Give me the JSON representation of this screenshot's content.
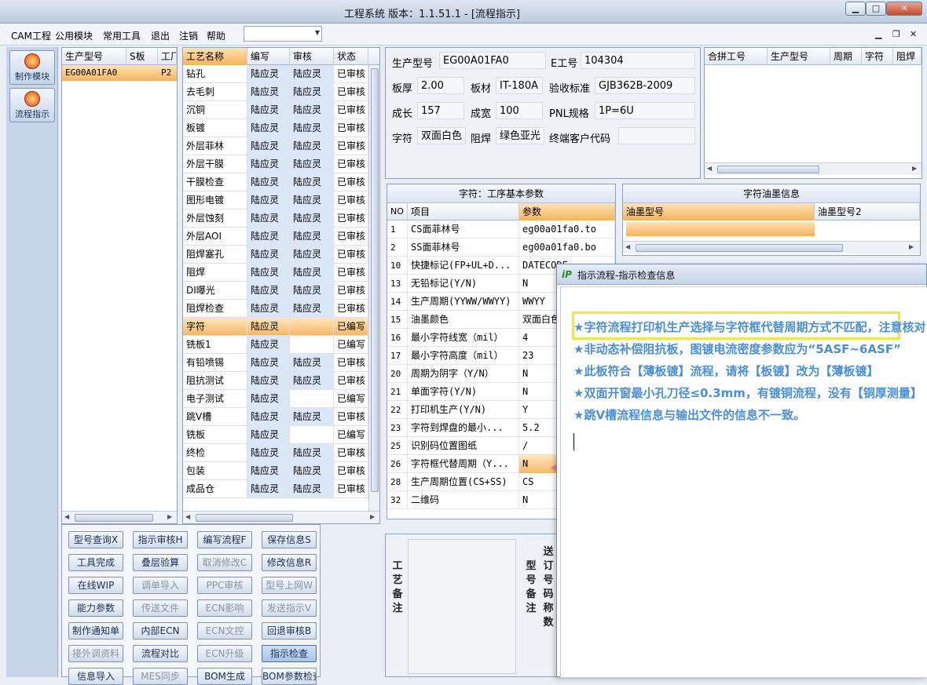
{
  "window": {
    "title": "工程系统   版本：1.1.51.1 - [流程指示]",
    "btn_min": "▁",
    "btn_max": "□",
    "btn_close": "✕"
  },
  "menu": {
    "items": [
      "CAM工程",
      "公用模块",
      "常用工具",
      "退出",
      "注销",
      "帮助"
    ],
    "combo_value": "",
    "mdi_min": "▁",
    "mdi_restore": "❐",
    "mdi_close": "✕"
  },
  "leftbar": {
    "make_module": "制作模块",
    "flow_indicate": "流程指示"
  },
  "model_list": {
    "headers": [
      "生产型号",
      "S板",
      "工厂"
    ],
    "rows": [
      [
        "EG00A01FA0",
        "",
        "P2"
      ]
    ]
  },
  "process_list": {
    "headers": [
      "工艺名称",
      "编写",
      "审核",
      "状态"
    ],
    "rows": [
      [
        "钻孔",
        "陆应灵",
        "陆应灵",
        "已审核"
      ],
      [
        "去毛刺",
        "陆应灵",
        "陆应灵",
        "已审核"
      ],
      [
        "沉铜",
        "陆应灵",
        "陆应灵",
        "已审核"
      ],
      [
        "板镀",
        "陆应灵",
        "陆应灵",
        "已审核"
      ],
      [
        "外层菲林",
        "陆应灵",
        "陆应灵",
        "已审核"
      ],
      [
        "外层干膜",
        "陆应灵",
        "陆应灵",
        "已审核"
      ],
      [
        "干膜检查",
        "陆应灵",
        "陆应灵",
        "已审核"
      ],
      [
        "图形电镀",
        "陆应灵",
        "陆应灵",
        "已审核"
      ],
      [
        "外层蚀刻",
        "陆应灵",
        "陆应灵",
        "已审核"
      ],
      [
        "外层AOI",
        "陆应灵",
        "陆应灵",
        "已审核"
      ],
      [
        "阻焊塞孔",
        "陆应灵",
        "陆应灵",
        "已审核"
      ],
      [
        "阻焊",
        "陆应灵",
        "陆应灵",
        "已审核"
      ],
      [
        "DI曝光",
        "陆应灵",
        "陆应灵",
        "已审核"
      ],
      [
        "阻焊检查",
        "陆应灵",
        "陆应灵",
        "已审核"
      ],
      [
        "字符",
        "陆应灵",
        "",
        "已编写"
      ],
      [
        "铣板1",
        "陆应灵",
        "",
        "已编写"
      ],
      [
        "有铅喷锡",
        "陆应灵",
        "陆应灵",
        "已审核"
      ],
      [
        "阻抗测试",
        "陆应灵",
        "陆应灵",
        "已审核"
      ],
      [
        "电子测试",
        "陆应灵",
        "",
        "已编写"
      ],
      [
        "跳V槽",
        "陆应灵",
        "陆应灵",
        "已审核"
      ],
      [
        "铣板",
        "陆应灵",
        "",
        "已编写"
      ],
      [
        "终检",
        "陆应灵",
        "陆应灵",
        "已审核"
      ],
      [
        "包装",
        "陆应灵",
        "陆应灵",
        "已审核"
      ],
      [
        "成品仓",
        "陆应灵",
        "陆应灵",
        "已审核"
      ]
    ],
    "active_index": 14
  },
  "buttons": [
    [
      "型号查询X",
      "指示审核H",
      "编写流程F",
      "保存信息S"
    ],
    [
      "工具完成",
      "叠层验算",
      "取消修改C",
      "修改信息R"
    ],
    [
      "在线WIP",
      "调单导入",
      "PPC审核",
      "型号上网W"
    ],
    [
      "能力参数",
      "传送文件",
      "ECN影响",
      "发送指示V"
    ],
    [
      "制作通知单",
      "内部ECN",
      "ECN文控",
      "回退审核B"
    ],
    [
      "接外调资料",
      "流程对比",
      "ECN升级",
      "指示检查"
    ],
    [
      "信息导入",
      "MES同步",
      "BOM生成",
      "BOM参数检查"
    ]
  ],
  "buttons_disabled": [
    [
      1,
      2
    ],
    [
      2,
      1
    ],
    [
      2,
      2
    ],
    [
      2,
      3
    ],
    [
      3,
      1
    ],
    [
      3,
      2
    ],
    [
      3,
      3
    ],
    [
      4,
      2
    ],
    [
      5,
      0
    ],
    [
      5,
      2
    ],
    [
      6,
      1
    ]
  ],
  "info": {
    "model_label": "生产型号",
    "model_value": "EG00A01FA0",
    "eng_label": "E工号",
    "eng_value": "104304",
    "thick_label": "板厚",
    "thick_value": "2.00",
    "mat_label": "板材",
    "mat_value": "IT-180A",
    "std_label": "验收标准",
    "std_value": "GJB362B-2009",
    "len_label": "成长",
    "len_value": "157",
    "wid_label": "成宽",
    "wid_value": "100",
    "pnl_label": "PNL规格",
    "pnl_value": "1P=6U",
    "char_label": "字符",
    "char_value": "双面白色",
    "mask_label": "阻焊",
    "mask_value": "绿色亚光",
    "cust_label": "终端客户代码",
    "cust_value": ""
  },
  "ping": {
    "headers": [
      "合拼工号",
      "生产型号",
      "周期",
      "字符",
      "阻焊"
    ]
  },
  "params": {
    "title": "字符：工序基本参数",
    "headers": [
      "NO",
      "项目",
      "参数"
    ],
    "rows": [
      [
        "1",
        "CS面菲林号",
        "eg00a01fa0.to"
      ],
      [
        "2",
        "SS面菲林号",
        "eg00a01fa0.bo"
      ],
      [
        "10",
        "快捷标记(FP+UL+D...",
        "DATECODE"
      ],
      [
        "13",
        "无铅标记(Y/N)",
        "N"
      ],
      [
        "14",
        "生产周期(YYWW/WWYY)",
        "WWYY"
      ],
      [
        "15",
        "油墨颜色",
        "双面白色"
      ],
      [
        "16",
        "最小字符线宽（mil）",
        "4"
      ],
      [
        "17",
        "最小字符高度（mil）",
        "23"
      ],
      [
        "20",
        "周期为阴字（Y/N）",
        "N"
      ],
      [
        "21",
        "单面字符(Y/N)",
        "N"
      ],
      [
        "22",
        "打印机生产(Y/N)",
        "Y"
      ],
      [
        "23",
        "字符到焊盘的最小...",
        "5.2"
      ],
      [
        "25",
        "识别码位置图纸",
        "/"
      ],
      [
        "26",
        "字符框代替周期（Y...",
        "N"
      ],
      [
        "28",
        "生产周期位置(CS+SS)",
        "CS"
      ],
      [
        "32",
        "二维码",
        "N"
      ]
    ],
    "highlight_index": 13
  },
  "ink": {
    "title": "字符油墨信息",
    "headers": [
      "油墨型号",
      "油墨型号2"
    ]
  },
  "notes": {
    "process_note_label": "工艺备注",
    "model_note_label": "型号备注",
    "order_label": "送订号码称数"
  },
  "dialog": {
    "logo": "iP",
    "title": "指示流程-指示检查信息",
    "messages": [
      "★字符流程打印机生产选择与字符框代替周期方式不匹配，注意核对！",
      "★非动态补偿阻抗板，图镀电流密度参数应为“5ASF~6ASF”",
      "★此板符合【薄板镀】流程，请将【板镀】改为【薄板镀】",
      "★双面开窗最小孔刀径≤0.3mm，有镀铜流程，没有【铜厚测量】",
      "★跳V槽流程信息与输出文件的信息不一致。"
    ]
  },
  "colors": {
    "accent_orange": "#f7b868",
    "message_blue": "#4a90d9",
    "highlight_yellow": "#f0e64c",
    "arrow_red": "#f08080"
  }
}
